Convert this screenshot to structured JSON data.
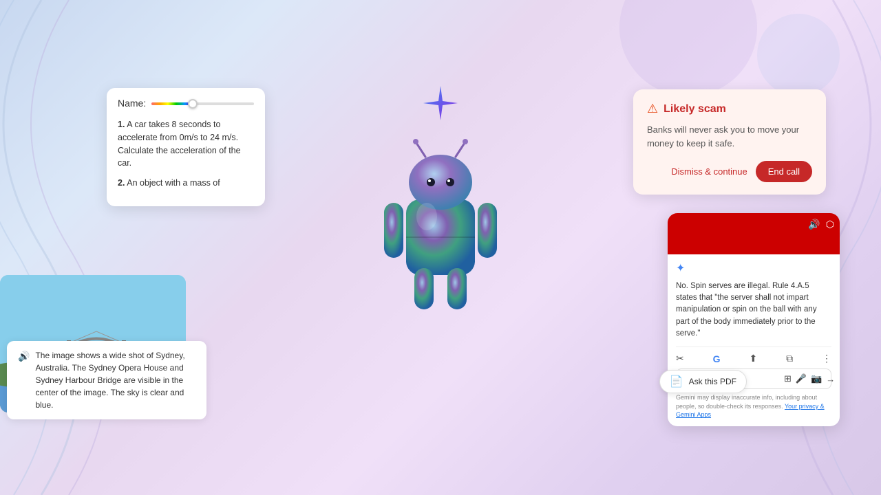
{
  "background": {
    "gradient_start": "#c8d8f0",
    "gradient_end": "#d8c8e8"
  },
  "quiz_card": {
    "name_label": "Name:",
    "items": [
      {
        "number": "1.",
        "text": "A car takes 8 seconds to accelerate from 0m/s to 24 m/s. Calculate the acceleration of the car."
      },
      {
        "number": "2.",
        "text": "An object with a mass of"
      }
    ]
  },
  "scam_card": {
    "title": "Likely scam",
    "body": "Banks will never ask you to move your money to keep it safe.",
    "dismiss_label": "Dismiss & continue",
    "end_call_label": "End call"
  },
  "sydney_card": {
    "caption": "The image shows a wide shot of Sydney, Australia. The Sydney Opera House and Sydney Harbour Bridge are visible in the center of the image. The sky is clear and blue."
  },
  "gemini_panel": {
    "response": "No. Spin serves are illegal. Rule 4.A.5 states that \"the server shall not impart manipulation or spin on the ball with any part of the body immediately prior to the serve.\"",
    "ask_pdf_label": "Ask this PDF",
    "disclaimer": "Gemini may display inaccurate info, including about people, so double-check its responses.",
    "disclaimer_link": "Your privacy & Gemini Apps"
  },
  "icons": {
    "speaker": "🔊",
    "warning": "⚠",
    "gemini_star": "✦",
    "volume": "🔊",
    "share": "⬆",
    "copy": "⧉",
    "more": "⋮",
    "screenshot": "📷",
    "mic": "🎤",
    "camera": "📸",
    "arrow_right": "→",
    "pdf": "📄",
    "google_g": "G",
    "scissors": "✂"
  }
}
